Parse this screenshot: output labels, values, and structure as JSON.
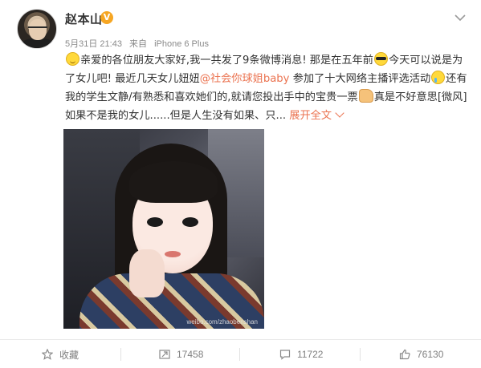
{
  "post": {
    "username": "赵本山",
    "verified_badge": "V",
    "date": "5月31日 21:43",
    "source_prefix": "来自",
    "source": "iPhone 6 Plus",
    "text_segments": {
      "s1": "亲爱的各位朋友大家好,我一共发了9条微博消息! 那是在五年前",
      "s2": "今天可以说是为了女儿吧! 最近几天女儿妞妞",
      "mention": "@社会你球姐baby",
      "s3": " 参加了十大网络主播评选活动",
      "s4": "还有我的学生文静/有熟悉和喜欢她们的,就请您投出手中的宝贵一票",
      "s5": "真是不好意思[微风]如果不是我的女儿......但是人生没有如果、只... ",
      "expand": "展开全文"
    },
    "photo_watermark": "weibo.com/zhaobenshan",
    "icons": {
      "menu": "chevron-down-icon",
      "favorite": "star-icon",
      "repost": "repost-icon",
      "comment": "comment-icon",
      "like": "thumbs-up-icon"
    }
  },
  "footer": {
    "favorite_label": "收藏",
    "repost_count": "17458",
    "comment_count": "11722",
    "like_count": "76130"
  },
  "colors": {
    "link": "#eb7350",
    "badge": "#f6a623",
    "muted": "#808080"
  }
}
